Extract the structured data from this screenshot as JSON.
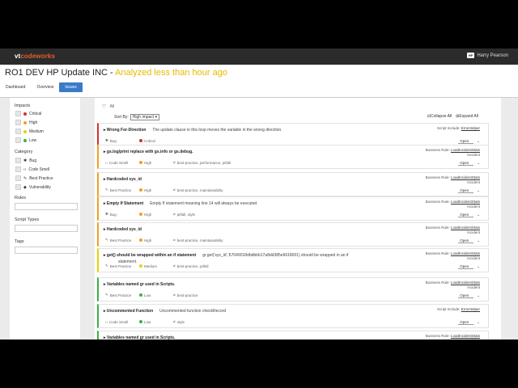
{
  "app": {
    "logo_a": "vt",
    "logo_b": "codeworks",
    "user_badge": "HP",
    "user_name": "Harry Pearson"
  },
  "header": {
    "title": "RO1 DEV HP Update INC - ",
    "subtitle": "Analyzed less than hour ago"
  },
  "tabs": [
    {
      "label": "Dashboard"
    },
    {
      "label": "Overview"
    },
    {
      "label": "Issues"
    }
  ],
  "sidebar": {
    "impacts_label": "Impacts",
    "impacts": [
      {
        "label": "Critical",
        "color": "#d32f2f"
      },
      {
        "label": "High",
        "color": "#f0a020"
      },
      {
        "label": "Medium",
        "color": "#e6d200"
      },
      {
        "label": "Low",
        "color": "#3cb043"
      }
    ],
    "category_label": "Category",
    "categories": [
      {
        "label": "Bug",
        "icon": "bug-icon"
      },
      {
        "label": "Code Smell",
        "icon": "code-icon"
      },
      {
        "label": "Best Practice",
        "icon": "edit-icon"
      },
      {
        "label": "Vulnerability",
        "icon": "shield-icon"
      }
    ],
    "rules_label": "Rules",
    "script_types_label": "Script Types",
    "tags_label": "Tags"
  },
  "content": {
    "filter_all": "All",
    "sort_label": "Sort By:",
    "sort_value": "High impact",
    "collapse_all": "Collapse All",
    "expand_all": "Expand All",
    "issues": [
      {
        "title": "Wrong For-Direction",
        "desc": "The update clause in this loop moves the variable in the wrong direction.",
        "desc2": "",
        "type": "Bug",
        "severity": "Critical",
        "sev_color": "#d32f2f",
        "tags": "",
        "right_type": "Script Include:",
        "right_link": "ErrorHelper",
        "right_sub": "",
        "status": "Open",
        "border": "#d32f2f"
      },
      {
        "title": "gs.log/print replace with gs.info or gs.debug.",
        "desc": "",
        "desc2": "",
        "type": "Code Smell",
        "severity": "High",
        "sev_color": "#f0a020",
        "tags": "best-practice, performance, pitfall",
        "right_type": "Business Rule:",
        "right_link": "LoadIncidentStats",
        "right_sub": "Incident",
        "status": "Open",
        "border": "#f0a020"
      },
      {
        "title": "Hardcoded sys_id",
        "desc": "",
        "desc2": "",
        "type": "Best Practice",
        "severity": "High",
        "sev_color": "#f0a020",
        "tags": "best-practice, maintainability",
        "right_type": "Business Rule:",
        "right_link": "LoadIncidentStats",
        "right_sub": "Incident",
        "status": "Open",
        "border": "#f0a020"
      },
      {
        "title": "Empty If Statement",
        "desc": "Empty If statement meaning line 14 will always be executed",
        "desc2": "",
        "type": "Bug",
        "severity": "High",
        "sev_color": "#f0a020",
        "tags": "pitfall, style",
        "right_type": "Business Rule:",
        "right_link": "LoadIncidentStats",
        "right_sub": "Incident",
        "status": "Open",
        "border": "#f0a020"
      },
      {
        "title": "Hardcoded sys_id",
        "desc": "",
        "desc2": "",
        "type": "Best Practice",
        "severity": "High",
        "sev_color": "#f0a020",
        "tags": "best-practice, maintainability",
        "right_type": "Business Rule:",
        "right_link": "LoadIncidentStats",
        "right_sub": "Incident",
        "status": "Open",
        "border": "#f0a020"
      },
      {
        "title": "get() should be wrapped within an if statement",
        "desc": "gr.get('sys_id','67049018dbdbbb17a8dd385e9618001) should be wrapped in an if",
        "desc2": "statement.",
        "type": "Best Practice",
        "severity": "Medium",
        "sev_color": "#e6d200",
        "tags": "best-practice, pitfall",
        "right_type": "Business Rule:",
        "right_link": "LoadIncidentStats",
        "right_sub": "Incident",
        "status": "Open",
        "border": "#e6d200"
      },
      {
        "title": "Variables named gr used in Scripts.",
        "desc": "",
        "desc2": "",
        "type": "Best Practice",
        "severity": "Low",
        "sev_color": "#3cb043",
        "tags": "best-practice",
        "right_type": "Business Rule:",
        "right_link": "LoadIncidentStats",
        "right_sub": "Incident",
        "status": "Open",
        "border": "#3cb043"
      },
      {
        "title": "Uncommented Function",
        "desc": "Uncommented function checkRecord",
        "desc2": "",
        "type": "Code Smell",
        "severity": "Low",
        "sev_color": "#3cb043",
        "tags": "style",
        "right_type": "Script Include:",
        "right_link": "ErrorHelper",
        "right_sub": "",
        "status": "Open",
        "border": "#3cb043"
      },
      {
        "title": "Variables named gr used in Scripts.",
        "desc": "",
        "desc2": "",
        "type": "",
        "severity": "",
        "sev_color": "#3cb043",
        "tags": "",
        "right_type": "Business Rule:",
        "right_link": "LoadIncidentStats",
        "right_sub": "Incident",
        "status": "",
        "border": "#3cb043"
      }
    ]
  }
}
